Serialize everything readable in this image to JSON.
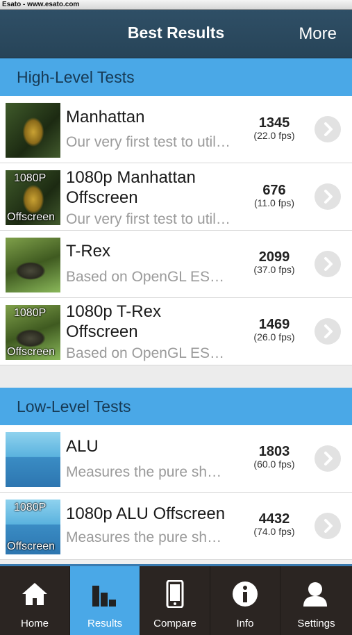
{
  "watermark": "Esato - www.esato.com",
  "header": {
    "title": "Best Results",
    "more_label": "More"
  },
  "sections": [
    {
      "title": "High-Level Tests",
      "items": [
        {
          "name": "Manhattan",
          "description": "Our very first test to util…",
          "score": "1345",
          "fps": "(22.0 fps)",
          "thumb_tag_top": "",
          "thumb_tag_bottom": ""
        },
        {
          "name": "1080p Manhattan Offscreen",
          "description": "Our very first test to util…",
          "score": "676",
          "fps": "(11.0 fps)",
          "thumb_tag_top": "1080P",
          "thumb_tag_bottom": "Offscreen"
        },
        {
          "name": "T-Rex",
          "description": "Based on OpenGL ES…",
          "score": "2099",
          "fps": "(37.0 fps)",
          "thumb_tag_top": "",
          "thumb_tag_bottom": ""
        },
        {
          "name": "1080p T-Rex Offscreen",
          "description": "Based on OpenGL ES…",
          "score": "1469",
          "fps": "(26.0 fps)",
          "thumb_tag_top": "1080P",
          "thumb_tag_bottom": "Offscreen"
        }
      ]
    },
    {
      "title": "Low-Level Tests",
      "items": [
        {
          "name": "ALU",
          "description": "Measures the pure sh…",
          "score": "1803",
          "fps": "(60.0 fps)",
          "thumb_tag_top": "",
          "thumb_tag_bottom": ""
        },
        {
          "name": "1080p ALU Offscreen",
          "description": "Measures the pure sh…",
          "score": "4432",
          "fps": "(74.0 fps)",
          "thumb_tag_top": "1080P",
          "thumb_tag_bottom": "Offscreen"
        }
      ]
    }
  ],
  "tabs": [
    {
      "label": "Home",
      "icon": "home-icon",
      "active": false
    },
    {
      "label": "Results",
      "icon": "results-icon",
      "active": true
    },
    {
      "label": "Compare",
      "icon": "compare-icon",
      "active": false
    },
    {
      "label": "Info",
      "icon": "info-icon",
      "active": false
    },
    {
      "label": "Settings",
      "icon": "settings-icon",
      "active": false
    }
  ],
  "colors": {
    "navbar": "#2f4f66",
    "section_header": "#4aa8e7",
    "active_tab": "#4aa8e7",
    "tabbar": "#2b2522"
  }
}
